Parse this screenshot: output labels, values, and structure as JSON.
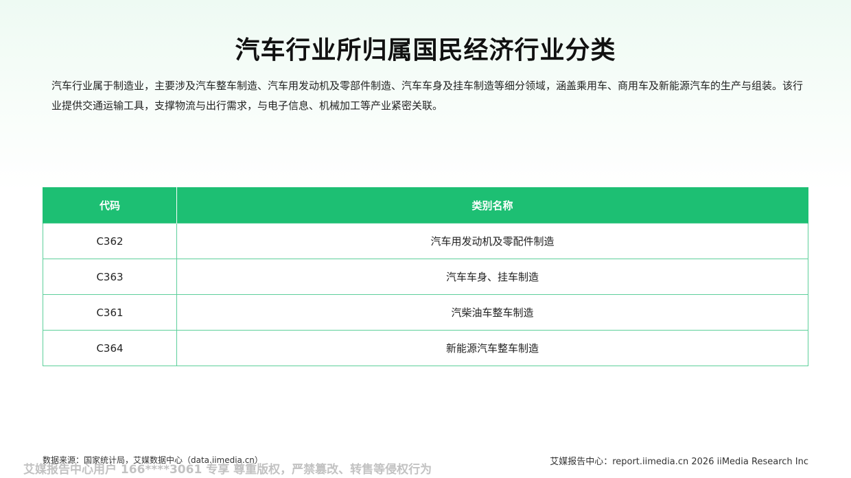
{
  "page": {
    "title": "汽车行业所归属国民经济行业分类",
    "intro": "汽车行业属于制造业，主要涉及汽车整车制造、汽车用发动机及零部件制造、汽车车身及挂车制造等细分领域，涵盖乘用车、商用车及新能源汽车的生产与组装。该行业提供交通运输工具，支撑物流与出行需求，与电子信息、机械加工等产业紧密关联。"
  },
  "table": {
    "headers": [
      "代码",
      "类别名称"
    ],
    "rows": [
      {
        "code": "C362",
        "name": "汽车用发动机及零配件制造"
      },
      {
        "code": "C363",
        "name": "汽车车身、挂车制造"
      },
      {
        "code": "C361",
        "name": "汽柴油车整车制造"
      },
      {
        "code": "C364",
        "name": "新能源汽车整车制造"
      }
    ]
  },
  "footer": {
    "source": "数据来源：国家统计局，艾媒数据中心（data.iimedia.cn）",
    "right": "艾媒报告中心：report.iimedia.cn   2026 iiMedia Research Inc",
    "watermark": "艾媒报告中心用户 166****3061 专享 尊重版权，严禁篡改、转售等侵权行为"
  },
  "colors": {
    "header_bg": "#1dbf73",
    "border": "#5ccf9a"
  }
}
